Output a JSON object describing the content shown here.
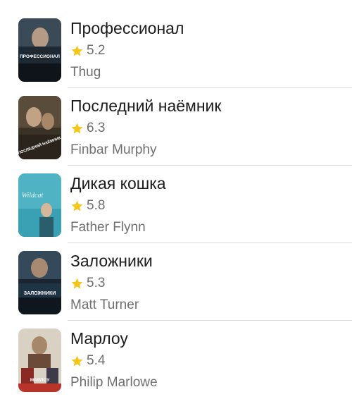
{
  "colors": {
    "star": "#f5c518",
    "divider": "#dcdcdc",
    "title": "#1c1c1c",
    "secondary": "#6f6f6f"
  },
  "films": [
    {
      "title": "Профессионал",
      "rating": "5.2",
      "role": "Thug",
      "poster_text": "ПРОФЕССИОНАЛ"
    },
    {
      "title": "Последний наёмник",
      "rating": "6.3",
      "role": "Finbar Murphy",
      "poster_text": "ПОСЛЕДНИЙ НАЁМНИК"
    },
    {
      "title": "Дикая кошка",
      "rating": "5.8",
      "role": "Father Flynn",
      "poster_text": "Wildcat"
    },
    {
      "title": "Заложники",
      "rating": "5.3",
      "role": "Matt Turner",
      "poster_text": "ЗАЛОЖНИКИ"
    },
    {
      "title": "Марлоу",
      "rating": "5.4",
      "role": "Philip Marlowe",
      "poster_text": "МАРЛОУ"
    }
  ]
}
